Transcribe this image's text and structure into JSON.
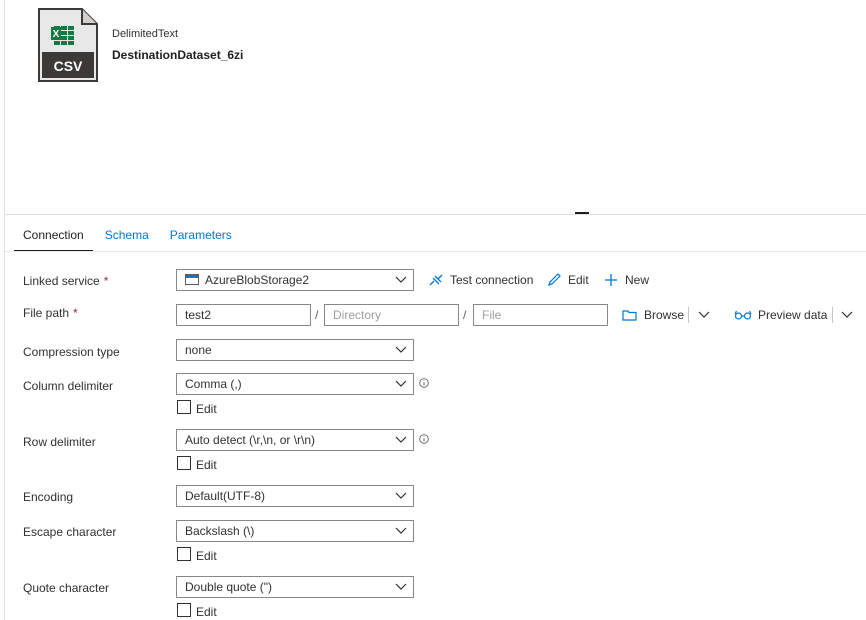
{
  "dataset": {
    "icon_text": "CSV",
    "type": "DelimitedText",
    "name": "DestinationDataset_6zi"
  },
  "tabs": [
    {
      "label": "Connection",
      "active": true
    },
    {
      "label": "Schema",
      "active": false
    },
    {
      "label": "Parameters",
      "active": false
    }
  ],
  "linked_service": {
    "label": "Linked service",
    "required": "*",
    "value": "AzureBlobStorage2",
    "test_connection": "Test connection",
    "edit": "Edit",
    "new": "New"
  },
  "file_path": {
    "label": "File path",
    "required": "*",
    "container": "test2",
    "directory_placeholder": "Directory",
    "file_placeholder": "File",
    "separator": "/",
    "browse": "Browse",
    "preview": "Preview data"
  },
  "compression_type": {
    "label": "Compression type",
    "value": "none"
  },
  "column_delimiter": {
    "label": "Column delimiter",
    "value": "Comma (,)",
    "edit_label": "Edit"
  },
  "row_delimiter": {
    "label": "Row delimiter",
    "value": "Auto detect (\\r,\\n, or \\r\\n)",
    "edit_label": "Edit"
  },
  "encoding": {
    "label": "Encoding",
    "value": "Default(UTF-8)"
  },
  "escape_character": {
    "label": "Escape character",
    "value": "Backslash (\\)",
    "edit_label": "Edit"
  },
  "quote_character": {
    "label": "Quote character",
    "value": "Double quote (\")",
    "edit_label": "Edit"
  },
  "colors": {
    "accent": "#0078d4",
    "required": "#a4262c",
    "csv_green": "#107c41",
    "icon_dark": "#3b3a39"
  }
}
